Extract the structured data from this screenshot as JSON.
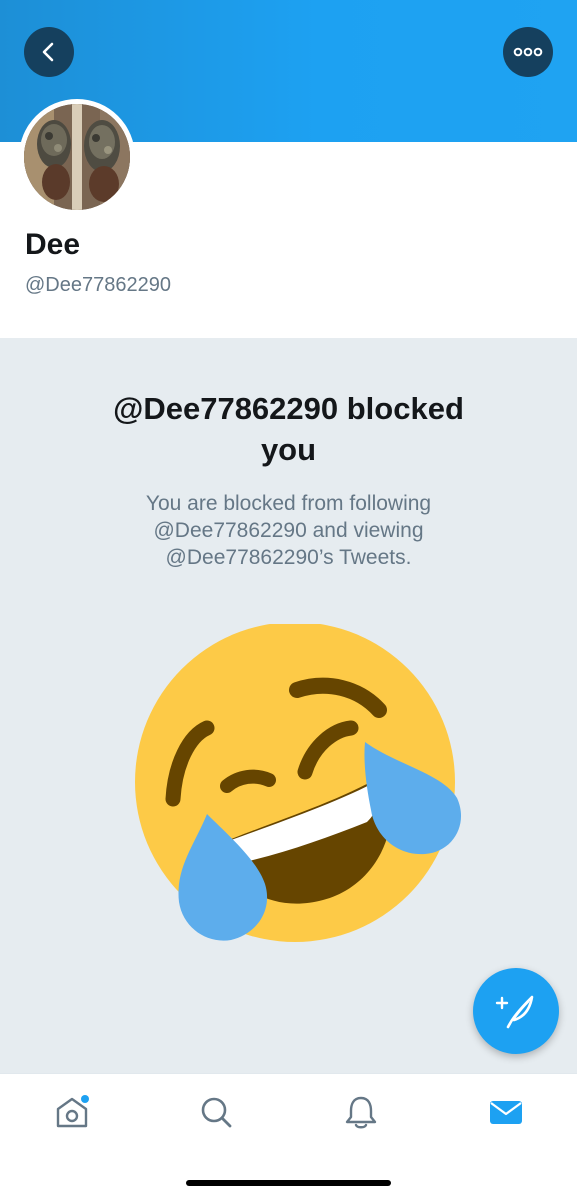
{
  "header": {
    "back_icon": "chevron-left-icon",
    "more_icon": "more-horizontal-icon",
    "banner_color": "#1da1f2"
  },
  "profile": {
    "name": "Dee",
    "handle": "@Dee77862290"
  },
  "blocked": {
    "title_line1": "@Dee77862290 blocked",
    "title_line2": "you",
    "desc_line1": "You are blocked from following",
    "desc_line2": "@Dee77862290 and viewing",
    "desc_line3": "@Dee77862290’s Tweets.",
    "emoji": "face-with-tears-of-joy"
  },
  "fab": {
    "icon": "compose-tweet-icon",
    "color": "#1da1f2"
  },
  "tabbar": {
    "tabs": [
      {
        "name": "home",
        "icon": "home-icon",
        "has_notification_dot": true,
        "active": false
      },
      {
        "name": "search",
        "icon": "search-icon",
        "active": false
      },
      {
        "name": "notifications",
        "icon": "bell-icon",
        "active": false
      },
      {
        "name": "messages",
        "icon": "mail-icon",
        "active": true
      }
    ],
    "accent_color": "#1da1f2",
    "inactive_color": "#657786"
  }
}
